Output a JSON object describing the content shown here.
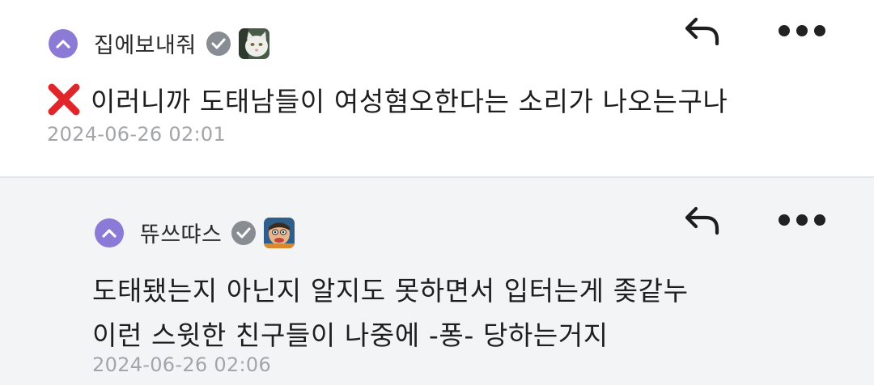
{
  "comments": [
    {
      "username": "집에보내줘",
      "body": "이러니까 도태남들이 여성혐오한다는 소리가 나오는구나",
      "timestamp": "2024-06-26 02:01",
      "status_icon": "red-x-icon",
      "avatar_icon": "white-cat-avatar"
    },
    {
      "username": "뜌쓰땨스",
      "body_lines": [
        "도태됐는지 아닌지 알지도 못하면서 입터는게 좆같누",
        "이런 스윗한 친구들이 나중에 -퐁- 당하는거지"
      ],
      "timestamp": "2024-06-26 02:06",
      "avatar_icon": "cartoon-face-avatar"
    }
  ],
  "colors": {
    "level_badge": "#8b7ad6",
    "reply_background": "#f3f4f6",
    "timestamp": "#a3a5a9",
    "verified_badge": "#888c93",
    "red_x": "#e0262b"
  },
  "icons": {
    "reply": "reply-arrow-icon",
    "more": "more-dots-icon",
    "level": "chevron-up-icon",
    "verified": "checkmark-icon"
  }
}
